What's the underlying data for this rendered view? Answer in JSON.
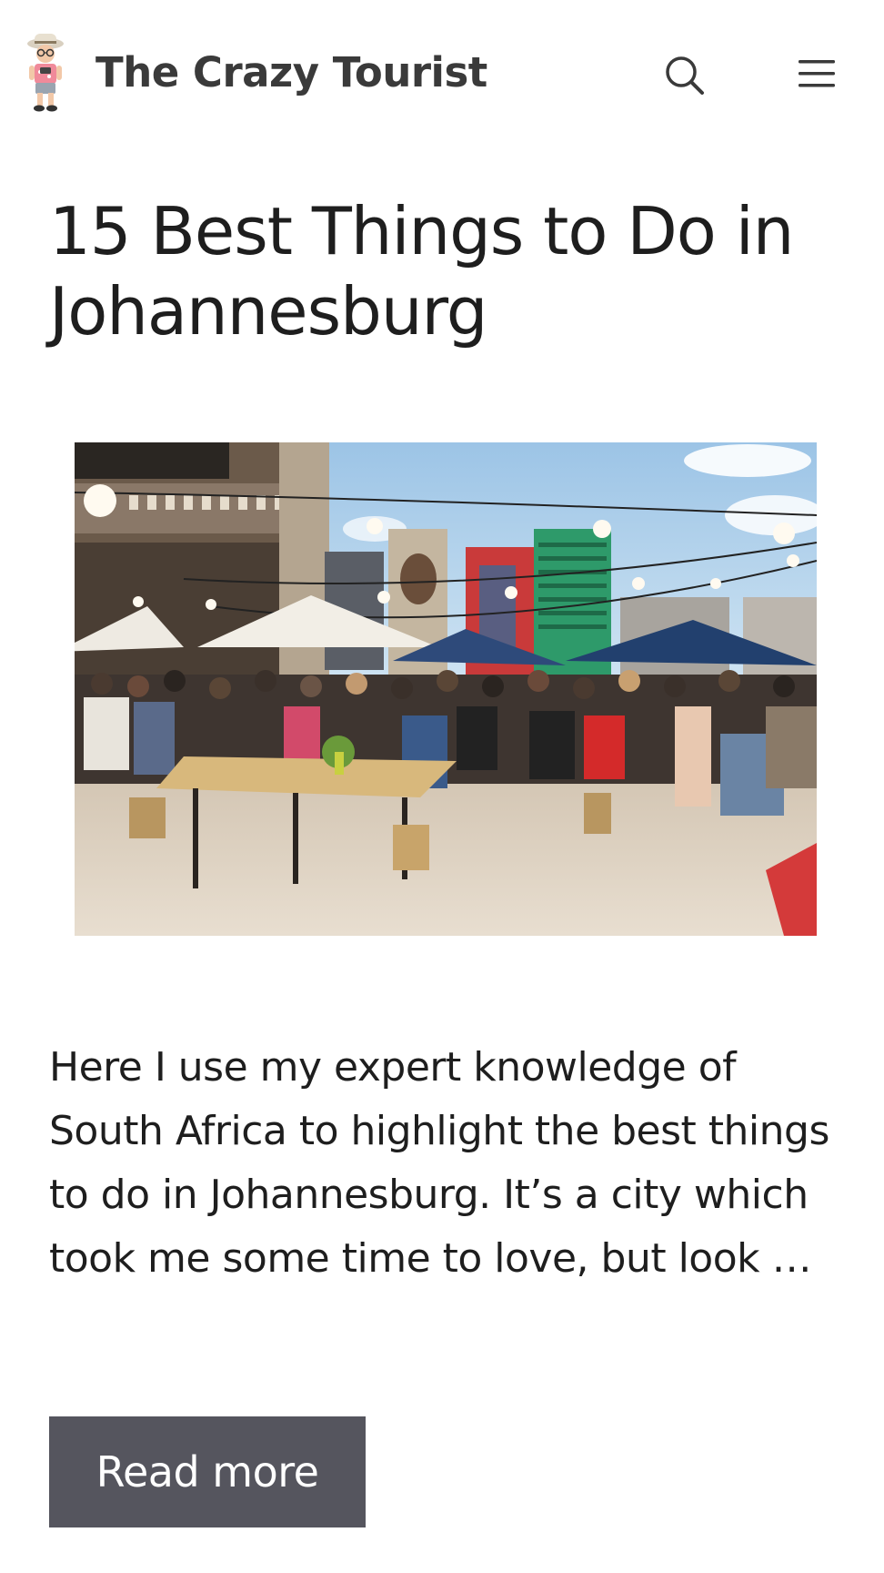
{
  "header": {
    "site_title": "The Crazy Tourist",
    "logo_icon": "tourist-mascot-icon",
    "search_icon": "search-icon",
    "menu_icon": "hamburger-menu-icon"
  },
  "article": {
    "title": "15 Best Things to Do in Johannesburg",
    "featured_image_description_icon": "featured-photo",
    "excerpt": "Here I use my expert knowledge of South Africa to highlight the best things to do in Johannesburg. It’s a city which took me some time to love, but look …",
    "read_more_label": "Read more"
  },
  "colors": {
    "button_bg": "#55555e",
    "title_text": "#1e1e1e",
    "site_title_text": "#3a3a3a"
  }
}
